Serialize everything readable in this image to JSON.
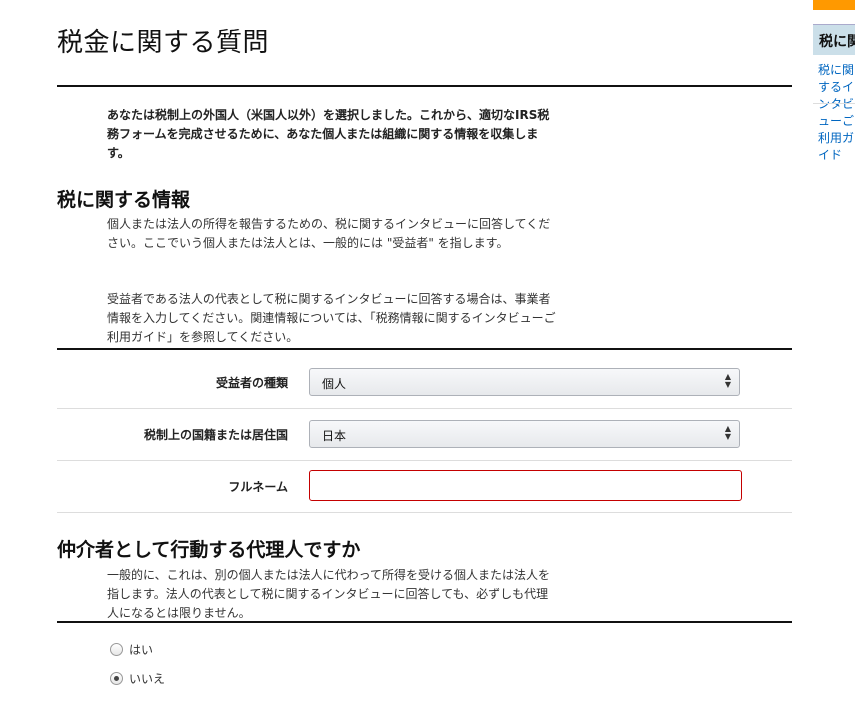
{
  "page": {
    "title": "税金に関する質問",
    "intro": "あなたは税制上の外国人（米国人以外）を選択しました。これから、適切なIRS税務フォームを完成させるために、あなた個人または組織に関する情報を収集します。"
  },
  "tax_info": {
    "heading": "税に関する情報",
    "para1": "個人または法人の所得を報告するための、税に関するインタビューに回答してください。ここでいう個人または法人とは、一般的には \"受益者\" を指します。",
    "para2": "受益者である法人の代表として税に関するインタビューに回答する場合は、事業者情報を入力してください。関連情報については、「税務情報に関するインタビューご利用ガイド」を参照してください。"
  },
  "form": {
    "beneficiary_type_label": "受益者の種類",
    "beneficiary_type_value": "個人",
    "country_label": "税制上の国籍または居住国",
    "country_value": "日本",
    "fullname_label": "フルネーム",
    "fullname_value": ""
  },
  "agent": {
    "heading": "仲介者として行動する代理人ですか",
    "para": "一般的に、これは、別の個人または法人に代わって所得を受ける個人または法人を指します。法人の代表として税に関するインタビューに回答しても、必ずしも代理人になるとは限りません。",
    "options": [
      {
        "label": "はい",
        "checked": false
      },
      {
        "label": "いいえ",
        "checked": true
      }
    ]
  },
  "sidebar": {
    "heading": "税に関",
    "link": "税に関するインタビューご利用ガイド"
  },
  "colors": {
    "accent": "#ff9900",
    "error_border": "#c40000",
    "link": "#0066c0",
    "side_box": "#cbdfe9"
  }
}
